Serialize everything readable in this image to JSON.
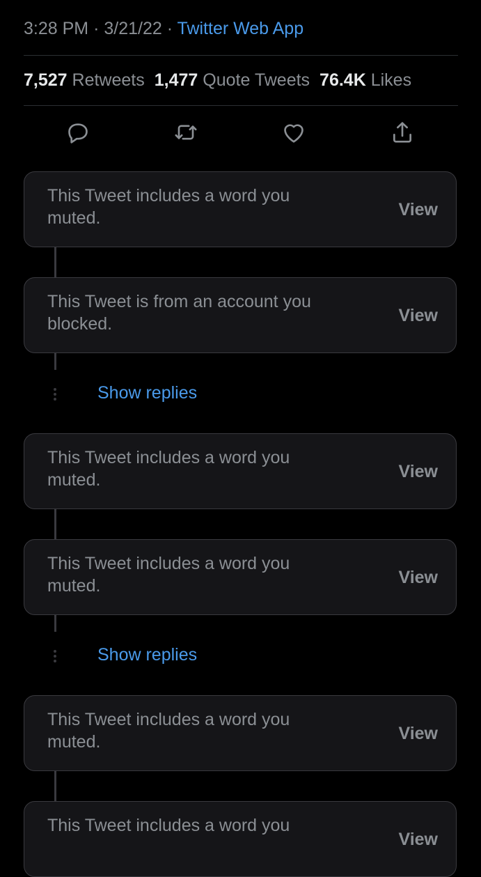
{
  "tweet": {
    "time": "3:28 PM",
    "date": "3/21/22",
    "separator": "·",
    "source": "Twitter Web App"
  },
  "stats": {
    "retweets_count": "7,527",
    "retweets_label": "Retweets",
    "quotes_count": "1,477",
    "quotes_label": "Quote Tweets",
    "likes_count": "76.4K",
    "likes_label": "Likes"
  },
  "actions": [
    "reply-icon",
    "retweet-icon",
    "like-icon",
    "share-icon"
  ],
  "replies": [
    {
      "message": "This Tweet includes a word you muted.",
      "action": "View"
    },
    {
      "message": "This Tweet is from an account you blocked.",
      "action": "View"
    },
    {
      "message": "This Tweet includes a word you muted.",
      "action": "View"
    },
    {
      "message": "This Tweet includes a word you muted.",
      "action": "View"
    },
    {
      "message": "This Tweet includes a word you muted.",
      "action": "View"
    },
    {
      "message": "This Tweet includes a word you",
      "action": "View"
    }
  ],
  "show_replies_label": "Show replies",
  "colors": {
    "background": "#000000",
    "link": "#4a9aea",
    "secondary_text": "#8b8f94",
    "card_background": "#151518",
    "card_border": "#3a3a3f"
  }
}
